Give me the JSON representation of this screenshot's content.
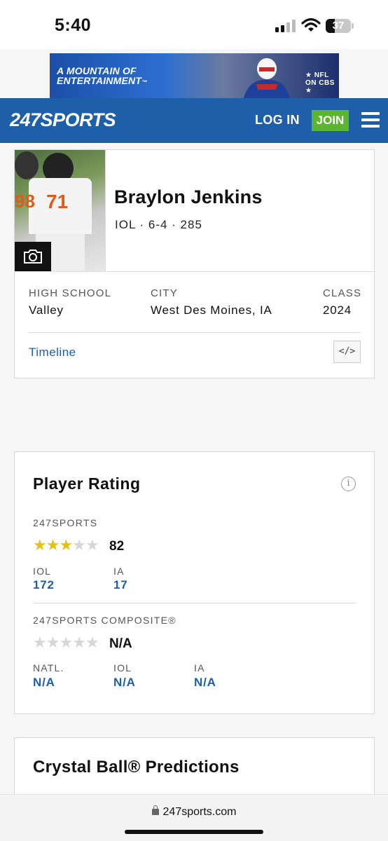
{
  "status_bar": {
    "time": "5:40",
    "battery": "37",
    "battery_level": 0.37
  },
  "ad": {
    "headline_1": "A MOUNTAIN OF",
    "headline_2": "ENTERTAINMENT",
    "trademark": "™",
    "tag": "★ NFL ON CBS ★"
  },
  "header": {
    "logo": "247SPORTS",
    "login": "LOG IN",
    "join": "JOIN",
    "colors": {
      "brand": "#1d5fa8",
      "join": "#5cb531"
    }
  },
  "player": {
    "name": "Braylon Jenkins",
    "meta": "IOL · 6-4 · 285",
    "high_school_label": "HIGH SCHOOL",
    "high_school": "Valley",
    "city_label": "CITY",
    "city": "West Des Moines, IA",
    "class_label": "CLASS",
    "class": "2024",
    "timeline": "Timeline",
    "embed": "</>"
  },
  "rating": {
    "title": "Player Rating",
    "info": "i",
    "s247": {
      "label": "247SPORTS",
      "stars_filled": 3,
      "stars_total": 5,
      "score": "82",
      "ranks": [
        {
          "label": "IOL",
          "value": "172"
        },
        {
          "label": "IA",
          "value": "17"
        }
      ]
    },
    "composite": {
      "label": "247SPORTS COMPOSITE®",
      "stars_filled": 0,
      "stars_total": 5,
      "score": "N/A",
      "ranks": [
        {
          "label": "NATL.",
          "value": "N/A"
        },
        {
          "label": "IOL",
          "value": "N/A"
        },
        {
          "label": "IA",
          "value": "N/A"
        }
      ]
    }
  },
  "crystal_ball": {
    "title": "Crystal Ball® Predictions"
  },
  "browser": {
    "url": "247sports.com"
  }
}
